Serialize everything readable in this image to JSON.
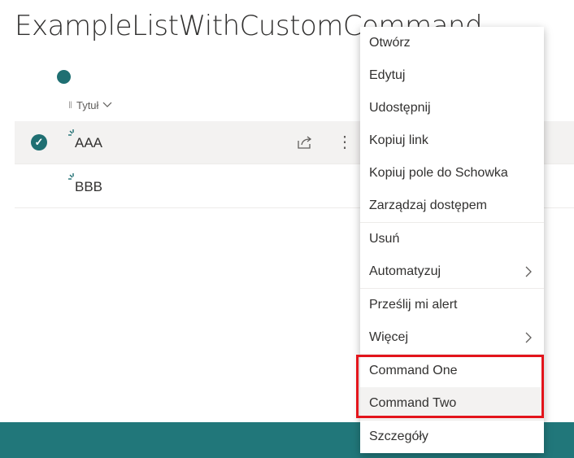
{
  "page": {
    "title": "ExampleListWithCustomCommand"
  },
  "list": {
    "column_header": "Tytuł",
    "rows": [
      {
        "title": "AAA",
        "selected": true
      },
      {
        "title": "BBB",
        "selected": false
      }
    ]
  },
  "context_menu": {
    "items": [
      {
        "label": "Otwórz"
      },
      {
        "label": "Edytuj"
      },
      {
        "label": "Udostępnij"
      },
      {
        "label": "Kopiuj link"
      },
      {
        "label": "Kopiuj pole do Schowka"
      },
      {
        "label": "Zarządzaj dostępem"
      },
      {
        "label": "Usuń"
      },
      {
        "label": "Automatyzuj",
        "submenu": true
      },
      {
        "label": "Prześlij mi alert"
      },
      {
        "label": "Więcej",
        "submenu": true
      },
      {
        "label": "Command One"
      },
      {
        "label": "Command Two"
      },
      {
        "label": "Szczegóły"
      }
    ]
  },
  "colors": {
    "accent": "#21777a",
    "highlight": "#e3141b"
  },
  "icons": {
    "check": "checkmark-icon",
    "share": "share-icon",
    "more": "more-vertical-icon",
    "new": "new-item-spark-icon",
    "chevron": "chevron-right-icon"
  }
}
